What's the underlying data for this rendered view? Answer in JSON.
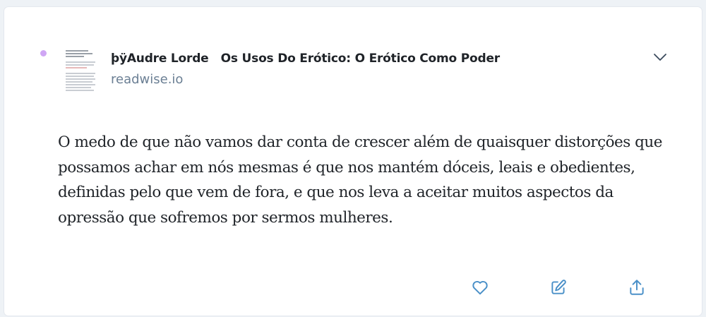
{
  "highlight": {
    "book_title": "þÿAudre Lorde   Os Usos Do Erótico: O Erótico Como Poder",
    "source": "readwise.io",
    "text": "O medo de que não vamos dar conta de crescer além de quaisquer distorções que possamos achar em nós mesmas é que nos mantém dóceis, leais e obedientes, definidas pelo que vem de fora, e que nos leva a aceitar muitos aspectos da opressão que sofremos por sermos mulheres."
  },
  "icons": {
    "unread_dot": "dot-icon",
    "expand": "chevron-down-icon",
    "favorite": "heart-icon",
    "edit": "edit-icon",
    "share": "share-icon"
  },
  "colors": {
    "accent": "#4a90c8",
    "unread_dot": "#cfa6f4",
    "source_text": "#6b7f94"
  }
}
